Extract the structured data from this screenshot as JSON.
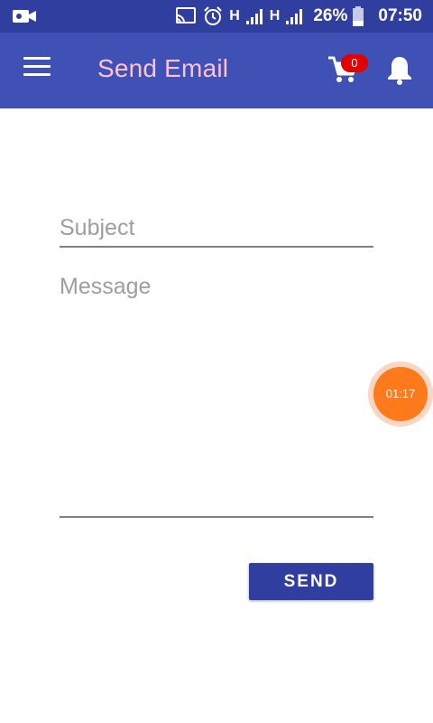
{
  "status_bar": {
    "network_type_1": "H",
    "network_type_2": "H",
    "battery_percent": "26%",
    "time": "07:50",
    "icons": [
      "video-camera-icon",
      "cast-icon",
      "alarm-icon",
      "signal-icon",
      "signal-icon",
      "battery-icon"
    ]
  },
  "app_bar": {
    "title": "Send Email",
    "cart_count": "0",
    "icons": [
      "menu-icon",
      "cart-icon",
      "bell-icon"
    ]
  },
  "form": {
    "subject_placeholder": "Subject",
    "subject_value": "",
    "message_placeholder": "Message",
    "message_value": "",
    "send_label": "SEND"
  },
  "timer": {
    "label": "01:17"
  },
  "colors": {
    "status_bar": "#303f9f",
    "app_bar": "#3f51b5",
    "title": "#ffc1d4",
    "badge": "#e00000",
    "button": "#303f9f",
    "timer": "#ff7a1a"
  }
}
